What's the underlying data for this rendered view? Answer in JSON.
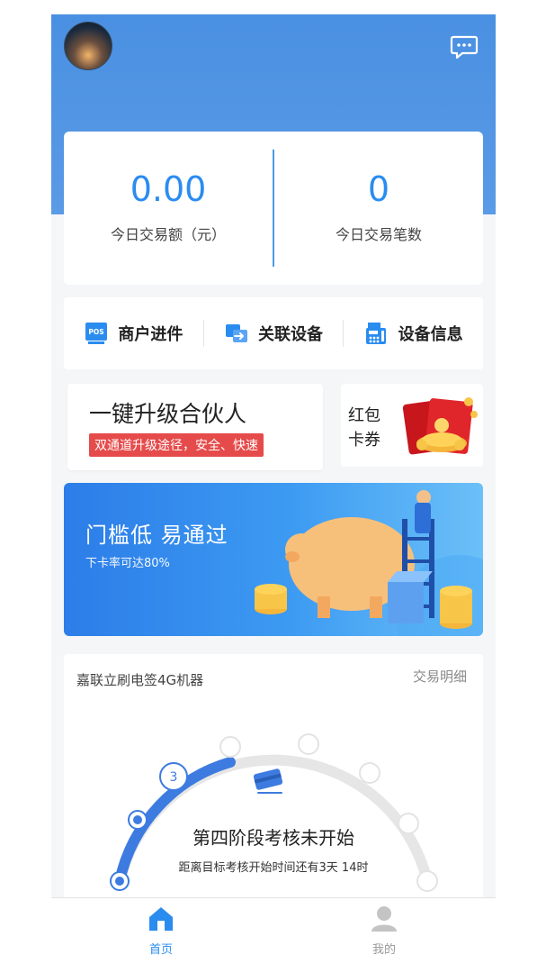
{
  "header": {
    "avatar_icon": "user-avatar",
    "message_icon": "chat-bubble-icon"
  },
  "stats": {
    "amount_value": "0.00",
    "amount_label": "今日交易额（元）",
    "count_value": "0",
    "count_label": "今日交易笔数"
  },
  "quick_actions": [
    {
      "label": "商户进件",
      "icon": "pos-icon"
    },
    {
      "label": "关联设备",
      "icon": "link-device-icon"
    },
    {
      "label": "设备信息",
      "icon": "device-info-icon"
    }
  ],
  "partner": {
    "title": "一键升级合伙人",
    "tag": "双通道升级途径，安全、快速"
  },
  "coupon": {
    "label": "红包卡券",
    "icon": "red-envelope-icon"
  },
  "banner": {
    "title": "门槛低  易通过",
    "subtitle": "下卡率可达80%"
  },
  "progress": {
    "device_name": "嘉联立刷电签4G机器",
    "detail_link": "交易明细",
    "current_step": "3",
    "phase_title": "第四阶段考核未开始",
    "phase_subtitle": "距离目标考核开始时间还有3天 14时",
    "steps_total": 8,
    "steps_completed": 3
  },
  "tabbar": {
    "home_label": "首页",
    "mine_label": "我的",
    "active": "home"
  },
  "colors": {
    "primary": "#2b8cf0",
    "header": "#4a90e2",
    "tag_red": "#e64b4b",
    "arc_active": "#3d7be0",
    "arc_inactive": "#e3e3e3"
  }
}
